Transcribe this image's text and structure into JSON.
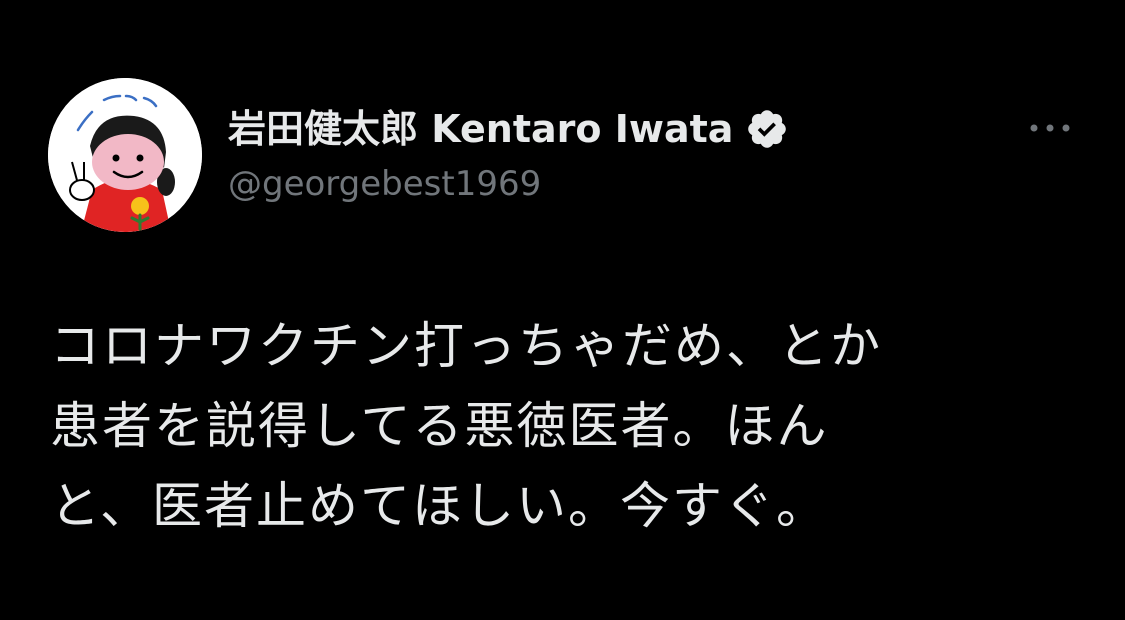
{
  "author": {
    "display_name": "岩田健太郎 Kentaro Iwata",
    "handle": "@georgebest1969",
    "verified_icon": "verified-badge-icon",
    "avatar_icon": "illustrated-avatar-icon"
  },
  "menu": {
    "icon": "more-options-icon"
  },
  "tweet": {
    "lines": [
      "コロナワクチン打っちゃだめ、とか",
      "患者を説得してる悪徳医者。ほん",
      "と、医者止めてほしい。今すぐ。"
    ]
  },
  "colors": {
    "background": "#000000",
    "text_primary": "#e7e9ea",
    "text_secondary": "#71767b",
    "badge": "#e7e9ea"
  }
}
